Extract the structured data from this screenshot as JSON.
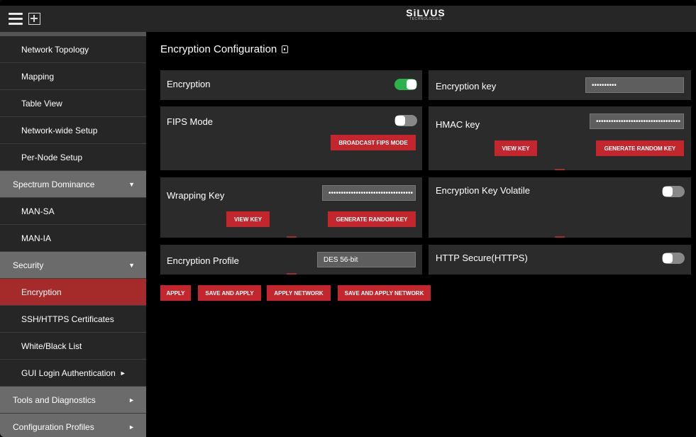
{
  "topbar": {
    "menu_icon": "hamburger-icon",
    "add_icon": "plus-square-icon",
    "brand": "SiLVUS",
    "brand_sub": "TECHNOLOGIES"
  },
  "sidebar": {
    "items": [
      {
        "label": "Network Topology",
        "type": "item"
      },
      {
        "label": "Mapping",
        "type": "item"
      },
      {
        "label": "Table View",
        "type": "item"
      },
      {
        "label": "Network-wide Setup",
        "type": "item"
      },
      {
        "label": "Per-Node Setup",
        "type": "item"
      },
      {
        "label": "Spectrum Dominance",
        "type": "section",
        "arrow": "▼"
      },
      {
        "label": "MAN-SA",
        "type": "item"
      },
      {
        "label": "MAN-IA",
        "type": "item"
      },
      {
        "label": "Security",
        "type": "section",
        "arrow": "▼"
      },
      {
        "label": "Encryption",
        "type": "active"
      },
      {
        "label": "SSH/HTTPS Certificates",
        "type": "item"
      },
      {
        "label": "White/Black List",
        "type": "item"
      },
      {
        "label": "GUI Login Authentication",
        "type": "item",
        "arrow": "►"
      },
      {
        "label": "Tools and Diagnostics",
        "type": "section",
        "arrow": "►"
      },
      {
        "label": "Configuration Profiles",
        "type": "section",
        "arrow": "►"
      }
    ]
  },
  "main": {
    "title": "Encryption Configuration",
    "title_icon": "info-icon",
    "encryption": {
      "label": "Encryption",
      "enabled": true
    },
    "encryption_key": {
      "label": "Encryption key",
      "value": "••••••••••"
    },
    "fips": {
      "label": "FIPS Mode",
      "enabled": false,
      "broadcast_label": "BROADCAST FIPS MODE"
    },
    "hmac": {
      "label": "HMAC key",
      "value": "••••••••••••••••••••••••••••••••••",
      "view_label": "VIEW KEY",
      "generate_label": "GENERATE RANDOM KEY"
    },
    "wrapping": {
      "label": "Wrapping Key",
      "value": "••••••••••••••••••••••••••••••••••",
      "view_label": "VIEW KEY",
      "generate_label": "GENERATE RANDOM KEY"
    },
    "key_volatile": {
      "label": "Encryption Key Volatile",
      "enabled": false
    },
    "profile": {
      "label": "Encryption Profile",
      "value": "DES 56-bit"
    },
    "https": {
      "label": "HTTP Secure(HTTPS)",
      "enabled": false
    },
    "actions": {
      "apply": "APPLY",
      "save_apply": "SAVE AND APPLY",
      "apply_network": "APPLY NETWORK",
      "save_apply_network": "SAVE AND APPLY NETWORK"
    }
  },
  "colors": {
    "accent_red": "#c4262e",
    "active_nav": "#a52a2a",
    "toggle_on": "#2bb34a"
  }
}
